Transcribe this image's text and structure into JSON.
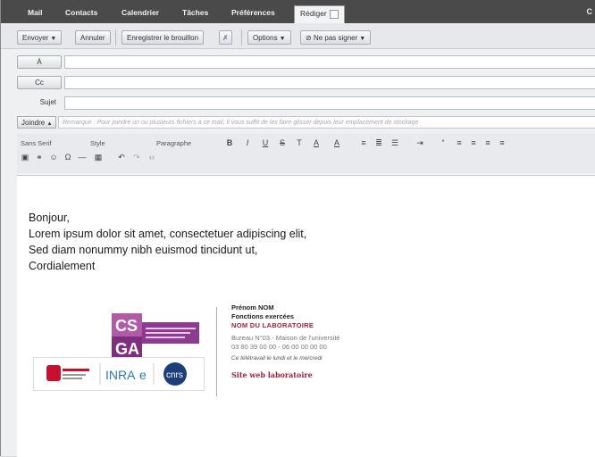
{
  "tabs": {
    "mail": "Mail",
    "contacts": "Contacts",
    "calendar": "Calendrier",
    "tasks": "Tâches",
    "preferences": "Préférences",
    "compose": "Rédiger"
  },
  "toolbar": {
    "send": "Envoyer",
    "cancel": "Annuler",
    "save_draft": "Enregistrer le brouillon",
    "options": "Options",
    "signature": "Ne pas signer"
  },
  "fields": {
    "to": "À",
    "cc": "Cc",
    "subject": "Sujet",
    "attach": "Joindre",
    "attach_hint": "Remarque : Pour joindre un ou plusieurs fichiers à ce mail, il vous suffit de les faire glisser depuis leur emplacement de stockage"
  },
  "format": {
    "font": "Sans Serif",
    "style": "Style",
    "paragraph": "Paragraphe"
  },
  "message": {
    "lines": [
      "Bonjour,",
      "Lorem ipsum dolor sit amet, consectetuer adipiscing elit,",
      "Sed diam nonummy nibh euismod tincidunt ut,",
      "Cordialement"
    ]
  },
  "signature": {
    "name": "Prénom NOM",
    "function": "Fonctions exercées",
    "lab": "NOM DU LABORATOIRE",
    "office": "Bureau N°03 - Maison de l'université",
    "phones": "03 80 39 00 00 - 06 00 00 00 00",
    "note": "Ce télétravail le lundi et le mercredi",
    "web": "Site web laboratoire",
    "logo_text": "CSGA",
    "partners": [
      "Université Bourgogne Franche-Comté",
      "INRAE",
      "CNRS"
    ]
  },
  "colors": {
    "accent": "#a31f3a",
    "logo_purple": "#8c3b8f"
  }
}
